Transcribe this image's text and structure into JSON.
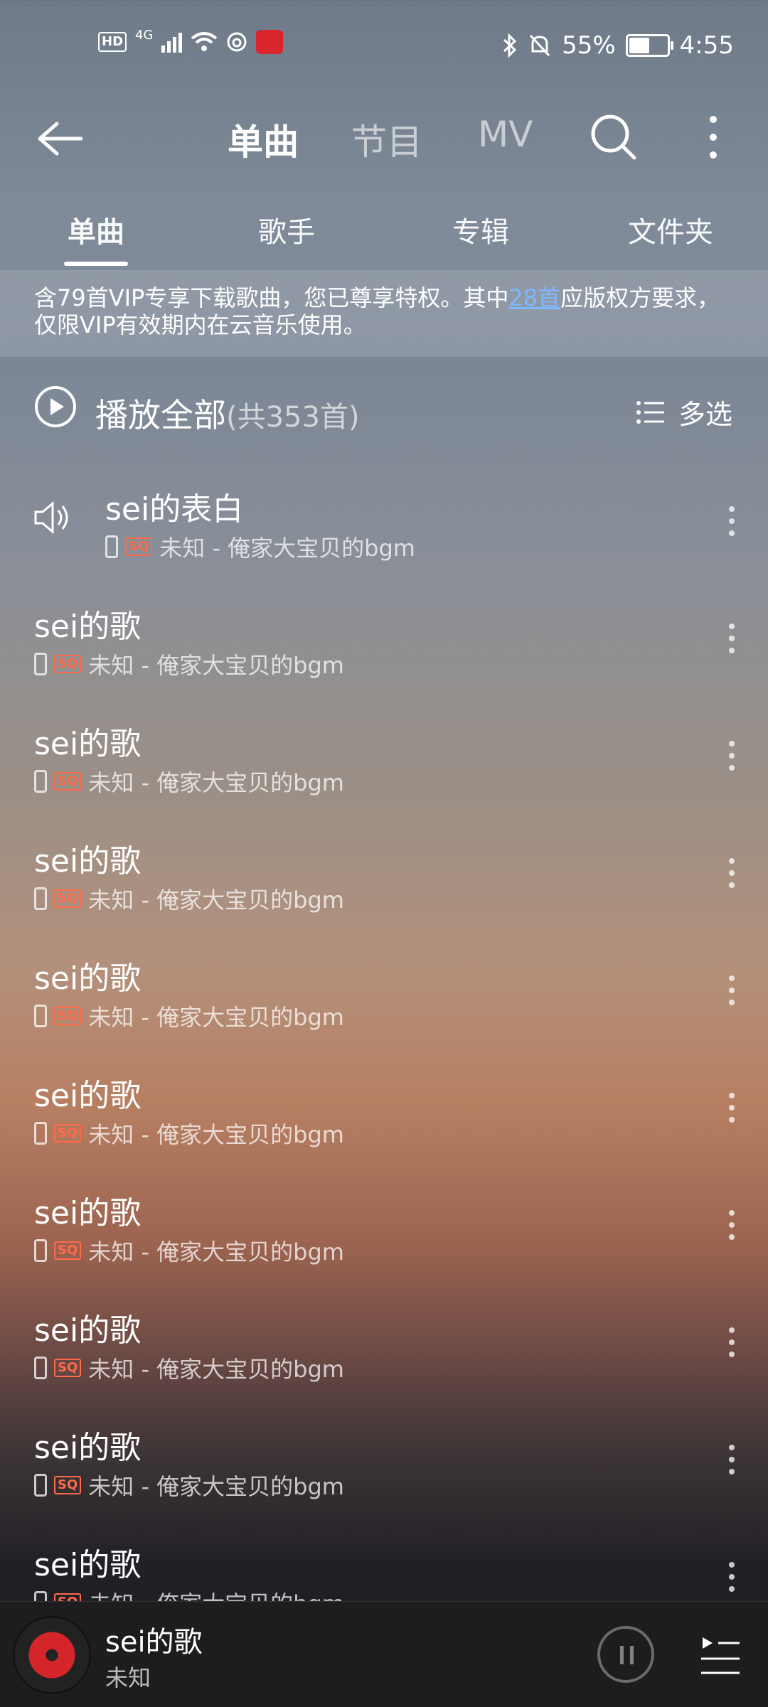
{
  "status_bar": {
    "hd": "HD",
    "network": "4G",
    "battery_percent": "55%",
    "battery_level": 0.55,
    "time": "4:55"
  },
  "header": {
    "tabs": [
      {
        "label": "单曲",
        "active": true
      },
      {
        "label": "节目",
        "active": false
      },
      {
        "label": "MV",
        "active": false
      }
    ]
  },
  "subtabs": [
    {
      "label": "单曲",
      "active": true
    },
    {
      "label": "歌手",
      "active": false
    },
    {
      "label": "专辑",
      "active": false
    },
    {
      "label": "文件夹",
      "active": false
    }
  ],
  "notice": {
    "before": "含79首VIP专享下载歌曲，您已尊享特权。其中",
    "link": "28首",
    "after": "应版权方要求，仅限VIP有效期内在云音乐使用。"
  },
  "playall": {
    "label": "播放全部",
    "count": "(共353首)",
    "multi_select": "多选"
  },
  "songs": [
    {
      "title": "sei的表白",
      "badge": "SQ",
      "meta": "未知 - 俺家大宝贝的bgm",
      "playing": true
    },
    {
      "title": "sei的歌",
      "badge": "SQ",
      "meta": "未知 - 俺家大宝贝的bgm"
    },
    {
      "title": "sei的歌",
      "badge": "SQ",
      "meta": "未知 - 俺家大宝贝的bgm"
    },
    {
      "title": "sei的歌",
      "badge": "SQ",
      "meta": "未知 - 俺家大宝贝的bgm"
    },
    {
      "title": "sei的歌",
      "badge": "SQ",
      "meta": "未知 - 俺家大宝贝的bgm"
    },
    {
      "title": "sei的歌",
      "badge": "SQ",
      "meta": "未知 - 俺家大宝贝的bgm"
    },
    {
      "title": "sei的歌",
      "badge": "SQ",
      "meta": "未知 - 俺家大宝贝的bgm"
    },
    {
      "title": "sei的歌",
      "badge": "SQ",
      "meta": "未知 - 俺家大宝贝的bgm"
    },
    {
      "title": "sei的歌",
      "badge": "SQ",
      "meta": "未知 - 俺家大宝贝的bgm"
    },
    {
      "title": "sei的歌",
      "badge": "SQ",
      "meta": "未知 - 俺家大宝贝的bgm"
    }
  ],
  "now_playing": {
    "title": "sei的歌",
    "artist": "未知"
  },
  "colors": {
    "accent_red": "#d4252b",
    "sq_badge": "#ff6a4a",
    "link": "#7fb8ff"
  }
}
